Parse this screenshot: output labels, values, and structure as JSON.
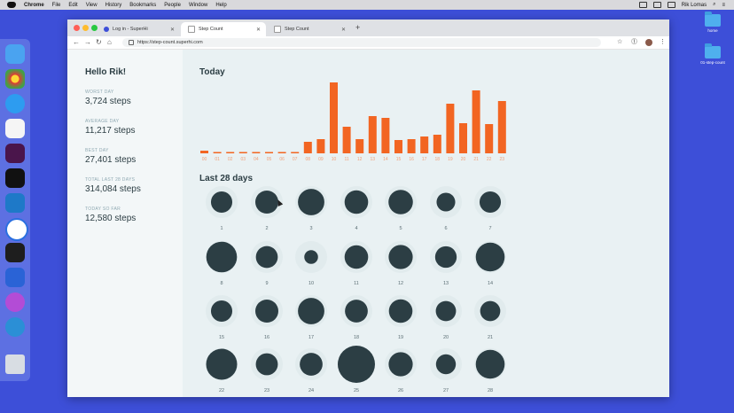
{
  "menubar": {
    "app": "Chrome",
    "items": [
      "File",
      "Edit",
      "View",
      "History",
      "Bookmarks",
      "People",
      "Window",
      "Help"
    ],
    "user": "Rik Lomas"
  },
  "desktop": {
    "folders": [
      "home",
      "01-step-count"
    ]
  },
  "browser": {
    "tabs": [
      {
        "title": "Log in - SuperHi"
      },
      {
        "title": "Step Count"
      },
      {
        "title": "Step Count"
      }
    ],
    "url": "https://step-count.superhi.com"
  },
  "sidebar": {
    "greeting": "Hello Rik!",
    "stats": [
      {
        "label": "WORST DAY",
        "value": "3,724 steps"
      },
      {
        "label": "AVERAGE DAY",
        "value": "11,217 steps"
      },
      {
        "label": "BEST DAY",
        "value": "27,401 steps"
      },
      {
        "label": "TOTAL LAST 28 DAYS",
        "value": "314,084 steps"
      },
      {
        "label": "TODAY SO FAR",
        "value": "12,580 steps"
      }
    ]
  },
  "today": {
    "title": "Today"
  },
  "days": {
    "title": "Last 28 days"
  },
  "colors": {
    "bar": "#f26522",
    "circle": "#2c3e44",
    "ring": "#dce7ea"
  },
  "chart_data": [
    {
      "type": "bar",
      "title": "Today",
      "categories": [
        "00",
        "01",
        "02",
        "03",
        "04",
        "05",
        "06",
        "07",
        "08",
        "09",
        "10",
        "11",
        "12",
        "13",
        "14",
        "15",
        "16",
        "17",
        "18",
        "19",
        "20",
        "21",
        "22",
        "23"
      ],
      "values": [
        3,
        0.5,
        0.5,
        0.5,
        0.5,
        0.5,
        0.5,
        0.5,
        13,
        16,
        80,
        30,
        16,
        42,
        40,
        15,
        16,
        19,
        21,
        56,
        34,
        71,
        33,
        59
      ]
    },
    {
      "type": "scatter",
      "title": "Last 28 days",
      "x": [
        "1",
        "2",
        "3",
        "4",
        "5",
        "6",
        "7",
        "8",
        "9",
        "10",
        "11",
        "12",
        "13",
        "14",
        "15",
        "16",
        "17",
        "18",
        "19",
        "20",
        "21",
        "22",
        "23",
        "24",
        "25",
        "26",
        "27",
        "28"
      ],
      "values": [
        9000,
        10500,
        13800,
        11000,
        11800,
        6900,
        9000,
        18600,
        9500,
        3724,
        11000,
        11500,
        9200,
        16500,
        9000,
        10500,
        13800,
        10300,
        11000,
        8100,
        8000,
        19000,
        9600,
        10300,
        27401,
        11500,
        7800,
        16500
      ]
    }
  ]
}
